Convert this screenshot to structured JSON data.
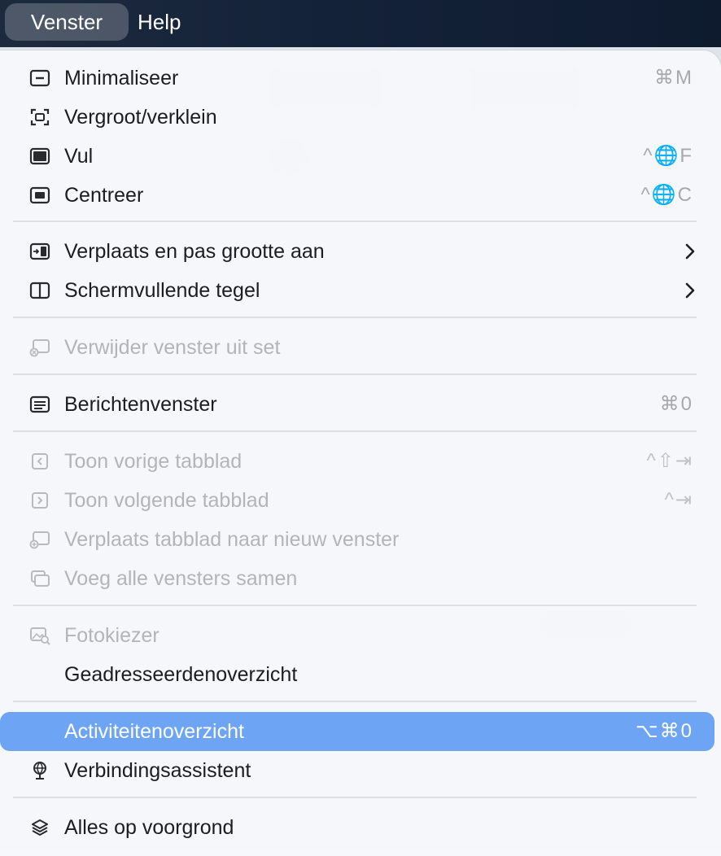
{
  "menubar": {
    "open_menu": "Venster",
    "help": "Help"
  },
  "menu": {
    "minimize": {
      "label": "Minimaliseer",
      "shortcut": "⌘M",
      "icon": "minimize-icon"
    },
    "zoom": {
      "label": "Vergroot/verklein",
      "icon": "zoom-icon"
    },
    "fill": {
      "label": "Vul",
      "shortcut": "^🌐F",
      "icon": "fill-window-icon"
    },
    "center": {
      "label": "Centreer",
      "shortcut": "^🌐C",
      "icon": "center-window-icon"
    },
    "move_resize": {
      "label": "Verplaats en pas grootte aan",
      "icon": "move-resize-icon"
    },
    "tile": {
      "label": "Schermvullende tegel",
      "icon": "split-view-icon"
    },
    "remove_from_set": {
      "label": "Verwijder venster uit set",
      "icon": "remove-window-icon"
    },
    "message_viewer": {
      "label": "Berichtenvenster",
      "shortcut": "⌘0",
      "icon": "message-viewer-icon"
    },
    "prev_tab": {
      "label": "Toon vorige tabblad",
      "shortcut": "^⇧⇥",
      "icon": "previous-tab-icon"
    },
    "next_tab": {
      "label": "Toon volgende tabblad",
      "shortcut": "^⇥",
      "icon": "next-tab-icon"
    },
    "move_tab": {
      "label": "Verplaats tabblad naar nieuw venster",
      "icon": "move-tab-icon"
    },
    "merge_windows": {
      "label": "Voeg alle vensters samen",
      "icon": "merge-windows-icon"
    },
    "photo_browser": {
      "label": "Fotokiezer",
      "icon": "photo-browser-icon"
    },
    "previous_recipients": {
      "label": "Geadresseerdenoverzicht"
    },
    "activity": {
      "label": "Activiteitenoverzicht",
      "shortcut": "⌥⌘0"
    },
    "connection_assistant": {
      "label": "Verbindingsassistent",
      "icon": "connection-assistant-icon"
    },
    "bring_all_front": {
      "label": "Alles op voorgrond",
      "icon": "layers-icon"
    }
  },
  "colors": {
    "highlight": "#6ea4f4",
    "menubar": "#15233a",
    "disabled_text": "#b3b4b8",
    "shortcut_text": "#a7a8ad"
  }
}
